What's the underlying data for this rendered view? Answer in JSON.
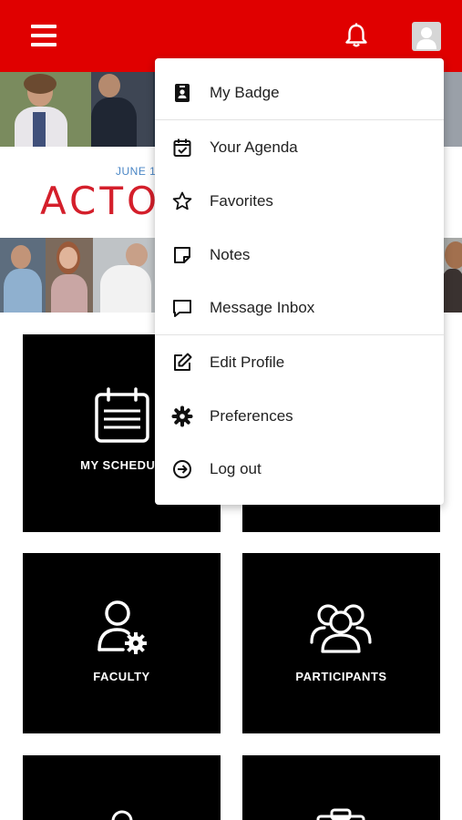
{
  "header": {
    "menu_icon": "hamburger-icon",
    "notification_icon": "bell-icon",
    "profile_icon": "user-avatar-icon",
    "brand_color": "#e00000"
  },
  "banner": {
    "date_text": "JUNE 1(",
    "title_text": "ACTO"
  },
  "tiles": [
    {
      "label": "MY SCHEDUL",
      "icon": "calendar-icon"
    },
    {
      "label": "",
      "icon": ""
    },
    {
      "label": "FACULTY",
      "icon": "faculty-gear-user-icon"
    },
    {
      "label": "PARTICIPANTS",
      "icon": "group-users-icon"
    }
  ],
  "menu": {
    "items": [
      {
        "label": "My Badge",
        "icon": "badge-icon"
      },
      {
        "label": "Your Agenda",
        "icon": "calendar-check-icon"
      },
      {
        "label": "Favorites",
        "icon": "star-icon"
      },
      {
        "label": "Notes",
        "icon": "note-icon"
      },
      {
        "label": "Message Inbox",
        "icon": "message-icon"
      },
      {
        "label": "Edit Profile",
        "icon": "edit-icon"
      },
      {
        "label": "Preferences",
        "icon": "gear-icon"
      },
      {
        "label": "Log out",
        "icon": "logout-icon"
      }
    ]
  }
}
